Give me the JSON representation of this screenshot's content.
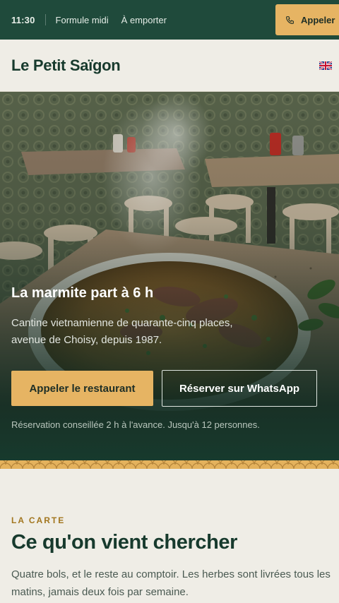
{
  "topbar": {
    "time": "11:30",
    "links": [
      "Formule midi",
      "À emporter"
    ],
    "call_label": "Appeler",
    "call_icon": "phone-icon"
  },
  "header": {
    "brand": "Le Petit Saïgon",
    "language_icon": "uk-flag-icon"
  },
  "hero": {
    "title": "La marmite part à 6 h",
    "subtitle": "Cantine vietnamienne de quarante-cinq places, avenue de Choisy, depuis 1987.",
    "primary_cta": "Appeler le restaurant",
    "secondary_cta": "Réserver sur WhatsApp",
    "note": "Réservation conseillée 2 h à l'avance. Jusqu'à 12 personnes."
  },
  "menu": {
    "eyebrow": "LA CARTE",
    "heading": "Ce qu'on vient chercher",
    "lead": "Quatre bols, et le reste au comptoir. Les herbes sont livrées tous les matins, jamais deux fois par semaine."
  },
  "colors": {
    "forest": "#1f4a3b",
    "gold": "#e6b463",
    "cream": "#efede6",
    "ink": "#173a2d"
  }
}
